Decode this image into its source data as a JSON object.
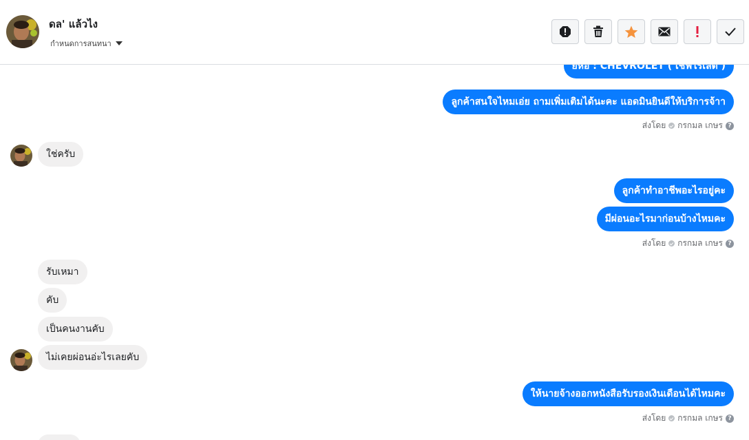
{
  "header": {
    "contact_name": "ดล' แล้วไง",
    "subtitle": "กำหนดการสนทนา",
    "actions": [
      "spam-icon",
      "trash-icon",
      "star-icon",
      "envelope-icon",
      "alert-icon",
      "check-icon"
    ],
    "colors": {
      "star": "#f5933d",
      "alert": "#e41e3f",
      "icon": "#1c1e21"
    }
  },
  "messages": {
    "m0": "ยี่ห้อ : CHEVROLET ( เชฟโรเลต )",
    "m1": "ลูกค้าสนใจไหมเอ่ย ถามเพิ่มเติมได้นะคะ แอดมินยินดีให้บริการจ้าา",
    "m2": "ใช่ครับ",
    "m3": "ลูกค้าทำอาชีพอะไรอยู่คะ",
    "m4": "มีผ่อนอะไรมาก่อนบ้างไหมคะ",
    "m5": "รับเหมา",
    "m6": "คับ",
    "m7": "เป็นคนงานคับ",
    "m8": "ไม่เคยผ่อนอ่ะไรเลยคับ",
    "m9": "ให้นายจ้างออกหนังสือรับรองเงินเดือนได้ไหมคะ"
  },
  "sent_by": {
    "prefix": "ส่งโดย",
    "name": "กรกมล เกษร"
  },
  "colors": {
    "outgoing_bubble": "#0a7cff",
    "incoming_bubble": "#f1f0f0"
  }
}
